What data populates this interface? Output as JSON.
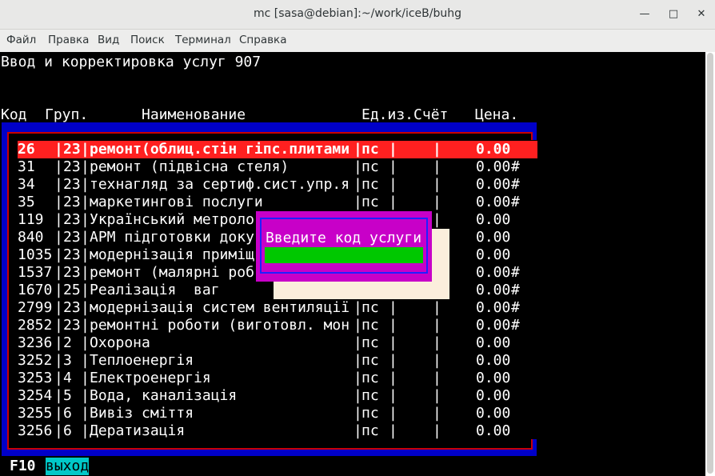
{
  "window": {
    "title": "mc [sasa@debian]:~/work/iceB/buhg",
    "minimize_glyph": "—",
    "maximize_glyph": "□",
    "close_glyph": "✕"
  },
  "menu": [
    "Файл",
    "Правка",
    "Вид",
    "Поиск",
    "Терминал",
    "Справка"
  ],
  "screen": {
    "heading": "Ввод и корректировка услуг 907",
    "columns": {
      "kod": "Код",
      "grup": "Груп.",
      "name": "Наименование",
      "unit_acc": "Ед.из.Счёт",
      "price": "Цена."
    }
  },
  "rows": [
    {
      "kod": "26",
      "grup": "23",
      "name": "ремонт(облиц.стін гіпс.плитами",
      "unit": "пс",
      "price": "0.00",
      "mark": ""
    },
    {
      "kod": "31",
      "grup": "23",
      "name": "ремонт (підвісна стеля)",
      "unit": "пс",
      "price": "0.00",
      "mark": "#"
    },
    {
      "kod": "34",
      "grup": "23",
      "name": "технагляд за сертиф.сист.упр.я",
      "unit": "пс",
      "price": "0.00",
      "mark": "#"
    },
    {
      "kod": "35",
      "grup": "23",
      "name": "маркетингові послуги",
      "unit": "пс",
      "price": "0.00",
      "mark": "#"
    },
    {
      "kod": "119",
      "grup": "23",
      "name": "Український метроло",
      "unit": "",
      "price": "0.00",
      "mark": ""
    },
    {
      "kod": "840",
      "grup": "23",
      "name": "АРМ підготовки доку",
      "unit": "",
      "price": "0.00",
      "mark": ""
    },
    {
      "kod": "1035",
      "grup": "23",
      "name": "модернізація приміщ",
      "unit": "",
      "price": "0.00",
      "mark": ""
    },
    {
      "kod": "1537",
      "grup": "23",
      "name": "ремонт (малярні роб",
      "unit": "",
      "price": "0.00",
      "mark": "#"
    },
    {
      "kod": "1670",
      "grup": "25",
      "name": "Реалізація  ваг",
      "unit": "",
      "price": "0.00",
      "mark": "#"
    },
    {
      "kod": "2799",
      "grup": "23",
      "name": "модернізація систем вентиляції",
      "unit": "пс",
      "price": "0.00",
      "mark": "#"
    },
    {
      "kod": "2852",
      "grup": "23",
      "name": "ремонтні роботи (виготовл. мон",
      "unit": "пс",
      "price": "0.00",
      "mark": "#"
    },
    {
      "kod": "3236",
      "grup": "2",
      "name": "Охорона",
      "unit": "пс",
      "price": "0.00",
      "mark": ""
    },
    {
      "kod": "3252",
      "grup": "3",
      "name": "Теплоенергія",
      "unit": "пс",
      "price": "0.00",
      "mark": ""
    },
    {
      "kod": "3253",
      "grup": "4",
      "name": "Електроенергія",
      "unit": "пс",
      "price": "0.00",
      "mark": ""
    },
    {
      "kod": "3254",
      "grup": "5",
      "name": "Вода, каналізація",
      "unit": "пс",
      "price": "0.00",
      "mark": ""
    },
    {
      "kod": "3255",
      "grup": "6",
      "name": "Вивіз сміття",
      "unit": "пс",
      "price": "0.00",
      "mark": ""
    },
    {
      "kod": "3256",
      "grup": "6",
      "name": "Дератизація",
      "unit": "пс",
      "price": "0.00",
      "mark": ""
    }
  ],
  "selected_row": 0,
  "dialog": {
    "title": "Введите код услуги",
    "value": ""
  },
  "footer": {
    "key": "F10",
    "label": "выход"
  },
  "colors": {
    "frame_blue": "#0000c8",
    "frame_red": "#c80000",
    "selection": "#ff2020",
    "dialog_magenta": "#c800c8",
    "input_green": "#00c800",
    "key_cyan": "#00c8c8"
  }
}
